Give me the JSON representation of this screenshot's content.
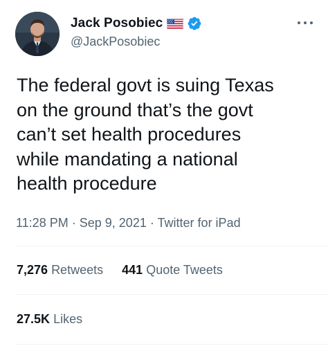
{
  "author": {
    "display_name": "Jack Posobiec",
    "handle": "@JackPosobiec",
    "flag_icon": "us-flag-emoji",
    "verified_icon": "verified-badge",
    "verified_color": "#1d9bf0"
  },
  "tweet": {
    "text": "The federal govt is suing Texas\non the ground that’s the govt\ncan’t set health procedures\nwhile mandating a national\nhealth procedure"
  },
  "meta": {
    "time": "11:28 PM",
    "separator": "·",
    "date": "Sep 9, 2021",
    "source": "Twitter for iPad"
  },
  "stats": {
    "retweets_count": "7,276",
    "retweets_label": "Retweets",
    "quotes_count": "441",
    "quotes_label": "Quote Tweets",
    "likes_count": "27.5K",
    "likes_label": "Likes"
  },
  "colors": {
    "text_primary": "#0f1419",
    "text_secondary": "#536471",
    "divider": "#eff3f4"
  }
}
